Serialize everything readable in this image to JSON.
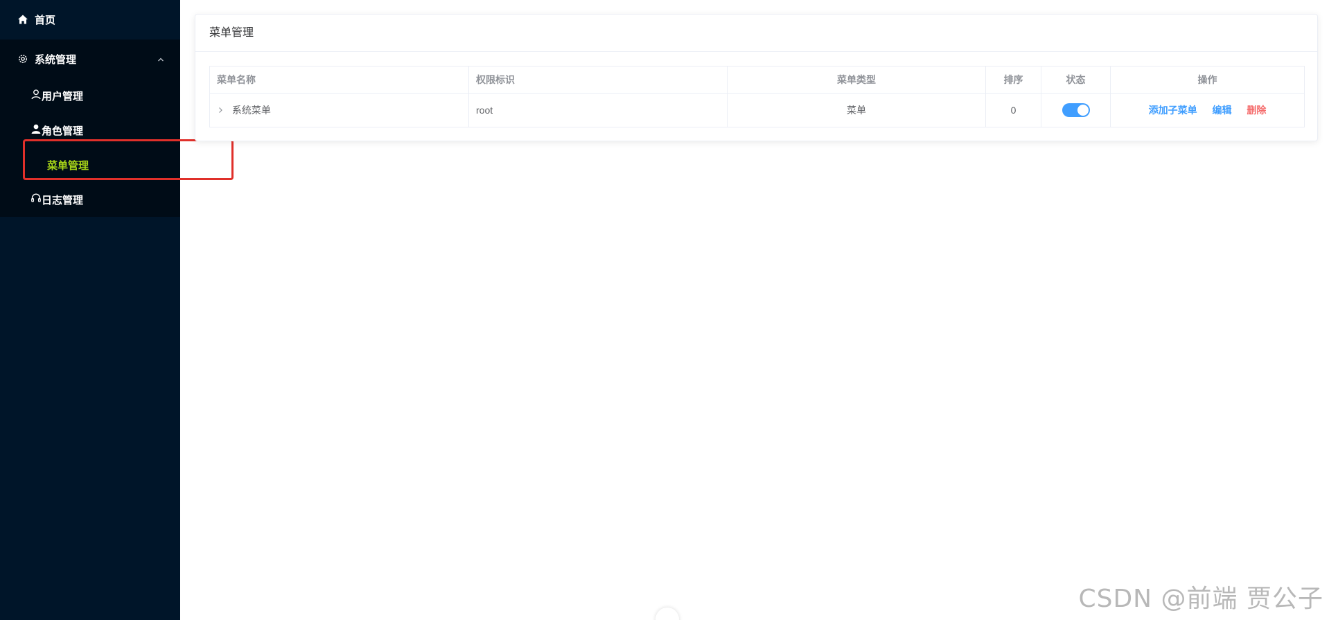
{
  "sidebar": {
    "home": {
      "label": "首页",
      "icon": "home-icon"
    },
    "system": {
      "label": "系统管理",
      "icon": "gear-icon",
      "expanded": true
    },
    "items": [
      {
        "label": "用户管理",
        "icon": "user-outline-icon"
      },
      {
        "label": "角色管理",
        "icon": "user-filled-icon"
      },
      {
        "label": "菜单管理",
        "active": true
      },
      {
        "label": "日志管理",
        "icon": "headset-icon"
      }
    ],
    "colors": {
      "background": "#001529",
      "active_text": "#a6d418",
      "highlight_border": "#e0302a"
    }
  },
  "main": {
    "card_title": "菜单管理",
    "table": {
      "headers": [
        "菜单名称",
        "权限标识",
        "菜单类型",
        "排序",
        "状态",
        "操作"
      ],
      "rows": [
        {
          "name": "系统菜单",
          "permission": "root",
          "type": "菜单",
          "sort": "0",
          "status_on": true,
          "actions": [
            "添加子菜单",
            "编辑",
            "删除"
          ]
        }
      ]
    },
    "colors": {
      "primary": "#409eff",
      "danger": "#f56c6c"
    }
  },
  "watermark": "CSDN @前端 贾公子"
}
